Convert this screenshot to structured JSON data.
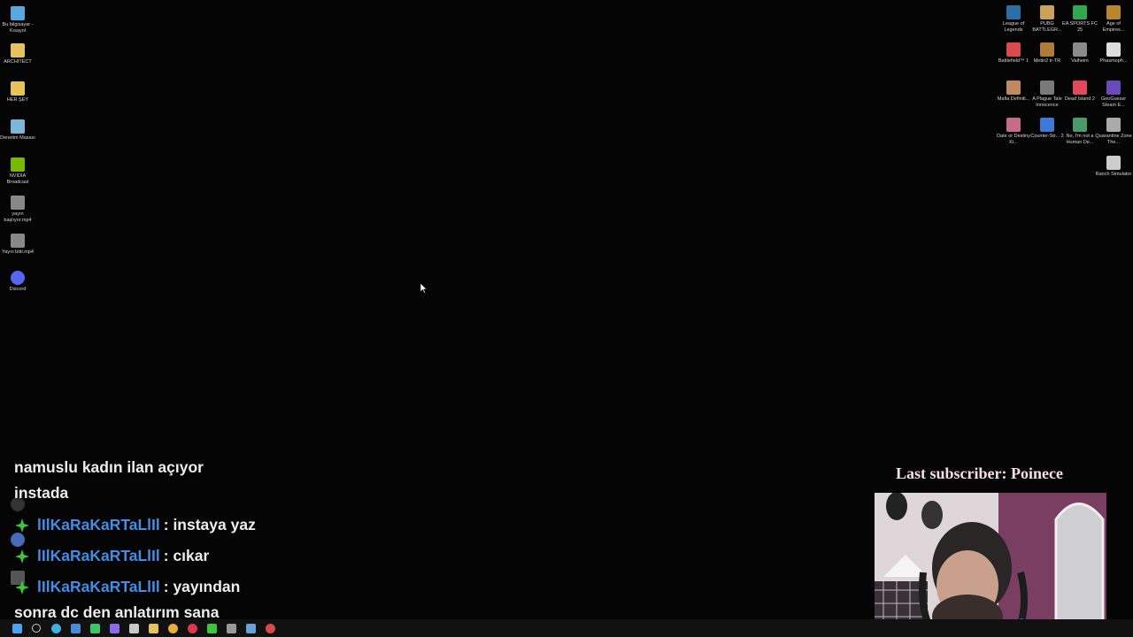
{
  "desktop_left": [
    {
      "label": "Bu bilgisayar - Kısayol",
      "icon": "monitor-icon",
      "color": "#5aa7e0"
    },
    {
      "label": "ARCHITECT",
      "icon": "folder-icon",
      "color": "#e6c35a"
    },
    {
      "label": "HER ŞEY",
      "icon": "folder-icon",
      "color": "#e6c35a"
    },
    {
      "label": "Denetim Masası",
      "icon": "control-panel-icon",
      "color": "#7bb7d8"
    },
    {
      "label": "NVIDIA Broadcast",
      "icon": "nvidia-icon",
      "color": "#76b900"
    },
    {
      "label": "yayın başlıyor.mp4",
      "icon": "video-file-icon",
      "color": "#888888"
    },
    {
      "label": "Yayın bitti.mp4",
      "icon": "video-file-icon",
      "color": "#888888"
    },
    {
      "label": "Discord",
      "icon": "discord-icon",
      "color": "#5865f2"
    }
  ],
  "desktop_right": [
    {
      "label": "League of Legends",
      "icon": "game-icon",
      "color": "#2c6fa8"
    },
    {
      "label": "PUBG BATTLEGR...",
      "icon": "game-icon",
      "color": "#c9a15a"
    },
    {
      "label": "EA SPORTS FC 25",
      "icon": "game-icon",
      "color": "#2fa84f"
    },
    {
      "label": "Age of Empires...",
      "icon": "game-icon",
      "color": "#b8862e"
    },
    {
      "label": "Battlefield™ 1",
      "icon": "game-icon",
      "color": "#d94a4a"
    },
    {
      "label": "Metin2 tr-TR",
      "icon": "game-icon",
      "color": "#b07a3a"
    },
    {
      "label": "Valheim",
      "icon": "game-icon",
      "color": "#8a8a8a"
    },
    {
      "label": "Phasmoph...",
      "icon": "game-icon",
      "color": "#dddddd"
    },
    {
      "label": "Mafia Definiti...",
      "icon": "game-icon",
      "color": "#c08a60"
    },
    {
      "label": "A Plague Tale Innocence",
      "icon": "game-icon",
      "color": "#7a7a7a"
    },
    {
      "label": "Dead Island 2",
      "icon": "game-icon",
      "color": "#e04a5a"
    },
    {
      "label": "GeoGuessr Steam E...",
      "icon": "game-icon",
      "color": "#6a4ab8"
    },
    {
      "label": "Date or Destiny Ki...",
      "icon": "game-icon",
      "color": "#c86a8a"
    },
    {
      "label": "Counter-Str... 2",
      "icon": "game-icon",
      "color": "#3a7ad8"
    },
    {
      "label": "No, I'm not a Human De...",
      "icon": "game-icon",
      "color": "#4a9a6a"
    },
    {
      "label": "Quarantine Zone The...",
      "icon": "game-icon",
      "color": "#aaaaaa"
    },
    {
      "label": "Ranch Simulator",
      "icon": "game-icon",
      "color": "#cccccc"
    }
  ],
  "chat": {
    "line1": "namuslu kadın ilan açıyor",
    "line2": "instada",
    "messages": [
      {
        "user": "lIlKaRaKaRTaLlIl",
        "text": ": instaya yaz"
      },
      {
        "user": "lIlKaRaKaRTaLlIl",
        "text": ": cıkar"
      },
      {
        "user": "lIlKaRaKaRTaLlIl",
        "text": ": yayından"
      }
    ],
    "line_last": "sonra dc den anlatırım sana"
  },
  "subscriber_banner": "Last subscriber: Poinece",
  "colors": {
    "username": "#3f8fe8",
    "badge": "#3ec43e",
    "taskbar": "#111111"
  },
  "taskbar_icons": [
    {
      "icon": "windows-start-icon",
      "color": "#4aa3f0"
    },
    {
      "icon": "search-icon",
      "color": "#cccccc"
    },
    {
      "icon": "edge-icon",
      "color": "#3fb0e0"
    },
    {
      "icon": "settings-icon",
      "color": "#4a8ad8"
    },
    {
      "icon": "whatsapp-icon",
      "color": "#3ec46a"
    },
    {
      "icon": "messenger-icon",
      "color": "#8a6ae8"
    },
    {
      "icon": "store-icon",
      "color": "#c8c8c8"
    },
    {
      "icon": "file-explorer-icon",
      "color": "#e6c35a"
    },
    {
      "icon": "chrome-icon",
      "color": "#e8b03a"
    },
    {
      "icon": "opera-icon",
      "color": "#e0384a"
    },
    {
      "icon": "xbox-icon",
      "color": "#3ec43e"
    },
    {
      "icon": "terminal-icon",
      "color": "#999999"
    },
    {
      "icon": "steam-icon",
      "color": "#6aa0d8"
    },
    {
      "icon": "obs-icon",
      "color": "#d84a4a"
    }
  ]
}
